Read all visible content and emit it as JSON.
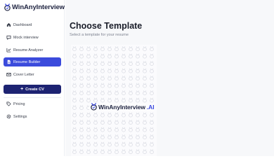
{
  "brand": {
    "name": "WinAnyInterview",
    "suffix": ".AI",
    "accent": "#3b49df",
    "dark": "#1e2340"
  },
  "sidebar": {
    "items": [
      {
        "label": "Dashboard",
        "icon": "home-icon",
        "active": false
      },
      {
        "label": "Mock interview",
        "icon": "chat-icon",
        "active": false
      },
      {
        "label": "Resume Analyzer",
        "icon": "chart-icon",
        "active": false
      },
      {
        "label": "Resume Builder",
        "icon": "document-icon",
        "active": true
      },
      {
        "label": "Cover Letter",
        "icon": "mail-icon",
        "active": false
      }
    ],
    "create_cv_label": "Create CV",
    "bottom_items": [
      {
        "label": "Pricing",
        "icon": "tag-icon"
      },
      {
        "label": "Settings",
        "icon": "gear-icon"
      }
    ]
  },
  "main": {
    "title": "Choose Template",
    "subtitle": "Select a template for your resume"
  },
  "colors": {
    "active_bg": "#3b4bdc",
    "create_bg": "#1d2372",
    "main_bg": "#f7f8fa"
  }
}
